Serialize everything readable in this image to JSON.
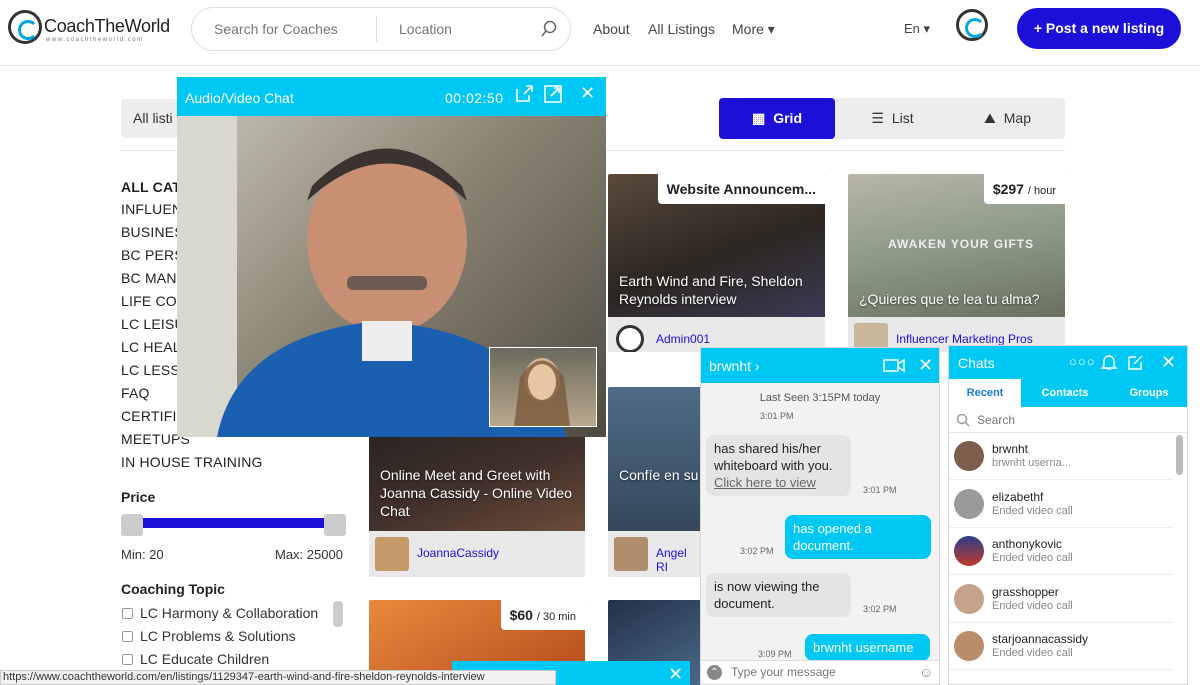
{
  "header": {
    "logo_text": "CoachTheWorld",
    "logo_sub": "www.coachtheworld.com",
    "search_placeholder": "Search for Coaches",
    "location_placeholder": "Location",
    "nav": [
      "About",
      "All Listings",
      "More ▾"
    ],
    "lang": "En ▾",
    "post_button": "+ Post a new listing"
  },
  "filter_chip": "All listi",
  "view": {
    "grid": "Grid",
    "list": "List",
    "map": "Map",
    "active": "grid"
  },
  "sidebar": {
    "categories": [
      "ALL CATI",
      "INFLUEN",
      "BUSINES",
      "BC PERS",
      "BC MANA",
      "LIFE COA",
      "LC LEISU",
      "LC HEALT",
      "LC LESSO",
      "FAQ",
      "CERTIFIC",
      "MEETUPS",
      "IN HOUSE TRAINING"
    ],
    "price_title": "Price",
    "min_label": "Min: 20",
    "max_label": "Max: 25000",
    "topic_title": "Coaching Topic",
    "topics": [
      "LC Harmony & Collaboration",
      "LC Problems & Solutions",
      "LC Educate Children"
    ]
  },
  "cards": [
    {
      "title": "Website Announcem...",
      "caption": "Earth Wind and Fire, Sheldon Reynolds interview",
      "owner": "Admin001"
    },
    {
      "badge": "$297",
      "badge_unit": "/ hour",
      "caption": "¿Quieres que te lea tu alma?",
      "overlay": "AWAKEN YOUR GIFTS",
      "owner": "Influencer Marketing Pros"
    },
    {
      "caption": "Online Meet and Greet with Joanna Cassidy - Online Video Chat",
      "owner": "JoannaCassidy"
    },
    {
      "caption": "Confíe en su ingrese a la e internaciona",
      "owner": "Angel RI"
    },
    {
      "badge": "$60",
      "badge_unit": "/ 30 min"
    }
  ],
  "video_chat": {
    "title": "Audio/Video Chat",
    "timer": "00:02:50"
  },
  "chat": {
    "name": "brwnht",
    "seen": "Last Seen 3:15PM today",
    "messages": [
      {
        "dir": "in",
        "text": "has shared his/her whiteboard with you.",
        "link": "Click here to view",
        "time": "3:01 PM"
      },
      {
        "dir": "out",
        "text": "has opened a document.",
        "time": "3:02 PM"
      },
      {
        "dir": "in",
        "text": "is now viewing the document.",
        "time": "3:02 PM"
      },
      {
        "dir": "out",
        "text": "brwnht username",
        "time": "3:09 PM"
      }
    ],
    "top_time": "3:01 PM",
    "input_placeholder": "Type your message"
  },
  "chats_panel": {
    "title": "Chats",
    "tabs": [
      "Recent",
      "Contacts",
      "Groups"
    ],
    "search_placeholder": "Search",
    "contacts": [
      {
        "name": "brwnht",
        "status": "brwnht userna..."
      },
      {
        "name": "elizabethf",
        "status": "Ended video call"
      },
      {
        "name": "anthonykovic",
        "status": "Ended video call"
      },
      {
        "name": "grasshopper",
        "status": "Ended video call"
      },
      {
        "name": "starjoannacassidy",
        "status": "Ended video call"
      }
    ]
  },
  "status_url": "https://www.coachtheworld.com/en/listings/1129347-earth-wind-and-fire-sheldon-reynolds-interview"
}
